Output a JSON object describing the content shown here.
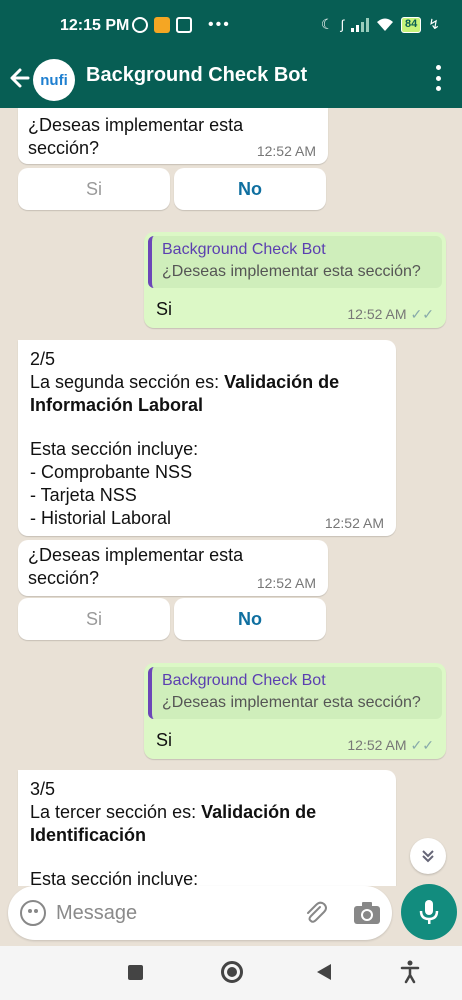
{
  "status_bar": {
    "time": "12:15 PM",
    "battery": "84",
    "dots": "•••"
  },
  "header": {
    "title": "Background Check Bot",
    "avatar_text": "nufi"
  },
  "messages": {
    "m1": {
      "text": "¿Deseas implementar esta sección?",
      "time": "12:52 AM"
    },
    "m1_quick": {
      "si": "Si",
      "no": "No"
    },
    "m2": {
      "quote_name": "Background Check Bot",
      "quote_text": "¿Deseas implementar esta sección?",
      "text": "Si",
      "time": "12:52 AM"
    },
    "m3": {
      "line1": "2/5",
      "intro": "La segunda sección es: ",
      "bold": "Validación de Información Laboral",
      "includes": "Esta sección incluye:",
      "items": [
        "- Comprobante NSS",
        "- Tarjeta NSS",
        "- Historial Laboral"
      ],
      "time": "12:52 AM"
    },
    "m4": {
      "text": "¿Deseas implementar esta sección?",
      "time": "12:52 AM"
    },
    "m4_quick": {
      "si": "Si",
      "no": "No"
    },
    "m5": {
      "quote_name": "Background Check Bot",
      "quote_text": "¿Deseas implementar esta sección?",
      "text": "Si",
      "time": "12:52 AM"
    },
    "m6": {
      "line1": "3/5",
      "intro": "La tercer sección es: ",
      "bold": "Validación de Identificación",
      "includes": "Esta sección incluye:"
    }
  },
  "input": {
    "placeholder": "Message"
  },
  "icons": {
    "back": "arrow-left-icon",
    "more": "more-vertical-icon",
    "emoji": "emoji-icon",
    "attach": "paperclip-icon",
    "camera": "camera-icon",
    "mic": "microphone-icon",
    "scroll": "chevrons-down-icon"
  },
  "colors": {
    "header": "#075e54",
    "outgoing_bubble": "#dcf8c6",
    "mic_button": "#128c7e",
    "quick_no": "#0f6fa0",
    "quote_bar": "#6b47b8"
  }
}
